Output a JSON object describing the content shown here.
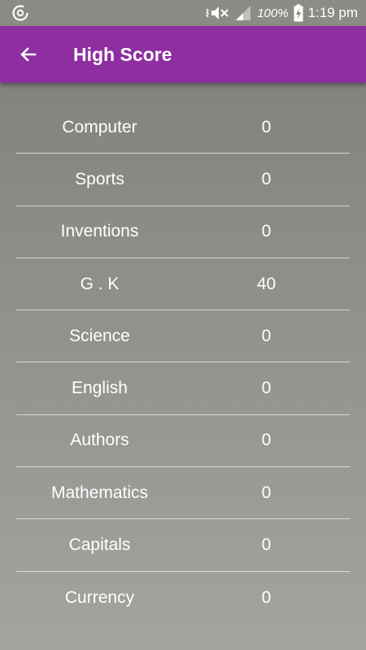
{
  "status_bar": {
    "battery": "100%",
    "time": "1:19 pm",
    "icons": [
      "sync-icon",
      "vibrate-mute-icon",
      "signal-icon",
      "battery-charging-icon"
    ]
  },
  "app_bar": {
    "title": "High Score",
    "back_icon": "arrow-left-icon",
    "background_color": "#8e2ea1"
  },
  "scores": [
    {
      "category": "Computer",
      "score": "0"
    },
    {
      "category": "Sports",
      "score": "0"
    },
    {
      "category": "Inventions",
      "score": "0"
    },
    {
      "category": "G . K",
      "score": "40"
    },
    {
      "category": "Science",
      "score": "0"
    },
    {
      "category": "English",
      "score": "0"
    },
    {
      "category": "Authors",
      "score": "0"
    },
    {
      "category": "Mathematics",
      "score": "0"
    },
    {
      "category": "Capitals",
      "score": "0"
    },
    {
      "category": "Currency",
      "score": "0"
    }
  ]
}
